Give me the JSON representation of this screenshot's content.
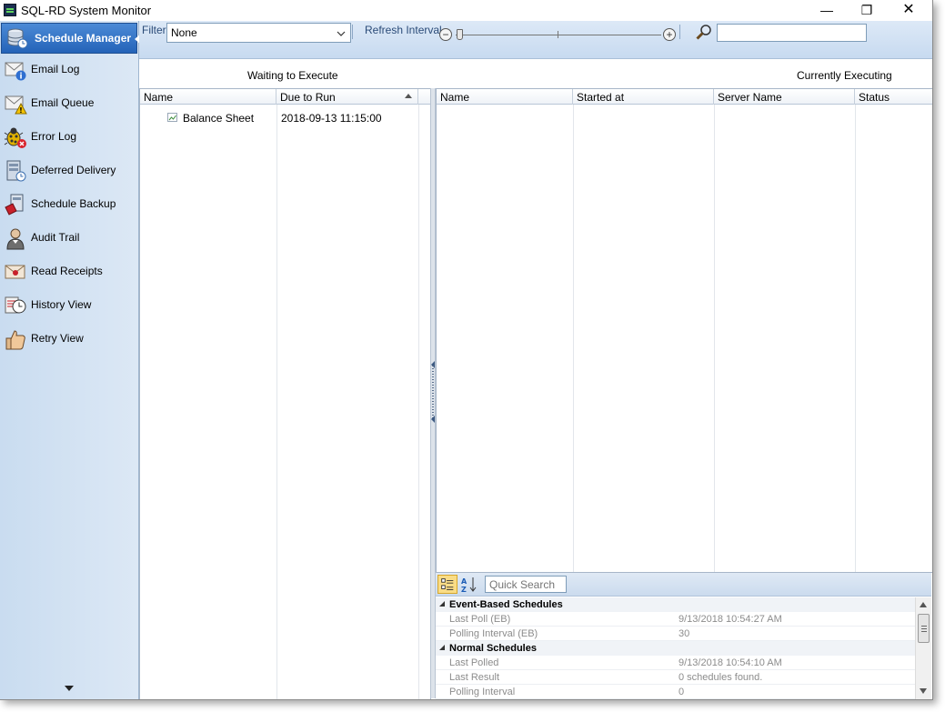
{
  "window": {
    "title": "SQL-RD System Monitor",
    "minimize": "—",
    "restore": "❐",
    "close": "✕"
  },
  "sidebar": {
    "active": {
      "label": "Schedule Manager",
      "icon": "database-clock-icon"
    },
    "items": [
      {
        "label": "Email Log",
        "icon": "envelope-info-icon"
      },
      {
        "label": "Email Queue",
        "icon": "envelope-warning-icon"
      },
      {
        "label": "Error Log",
        "icon": "bug-error-icon"
      },
      {
        "label": "Deferred Delivery",
        "icon": "server-clock-icon"
      },
      {
        "label": "Schedule Backup",
        "icon": "backup-icon"
      },
      {
        "label": "Audit Trail",
        "icon": "auditor-icon"
      },
      {
        "label": "Read Receipts",
        "icon": "envelope-seal-icon"
      },
      {
        "label": "History View",
        "icon": "history-clock-icon"
      },
      {
        "label": "Retry View",
        "icon": "thumbs-up-icon"
      }
    ]
  },
  "toolbar": {
    "filter_label": "Filter",
    "filter_value": "None",
    "refresh_label": "Refresh Interval",
    "refresh_level": 0.0,
    "search_value": ""
  },
  "waiting": {
    "title": "Waiting to Execute",
    "columns": [
      "Name",
      "Due to Run"
    ],
    "rows": [
      {
        "name": "Balance Sheet",
        "due": "2018-09-13 11:15:00"
      }
    ]
  },
  "executing": {
    "title": "Currently Executing",
    "columns": [
      "Name",
      "Started at",
      "Server Name",
      "Status"
    ]
  },
  "properties": {
    "search_placeholder": "Quick Search",
    "categories": [
      {
        "name": "Event-Based Schedules",
        "rows": [
          {
            "key": "Last Poll (EB)",
            "value": "9/13/2018 10:54:27 AM"
          },
          {
            "key": "Polling Interval (EB)",
            "value": "30"
          }
        ]
      },
      {
        "name": "Normal Schedules",
        "rows": [
          {
            "key": "Last Polled",
            "value": "9/13/2018 10:54:10 AM"
          },
          {
            "key": "Last Result",
            "value": "0 schedules found."
          },
          {
            "key": "Polling Interval",
            "value": "0"
          }
        ]
      }
    ]
  }
}
